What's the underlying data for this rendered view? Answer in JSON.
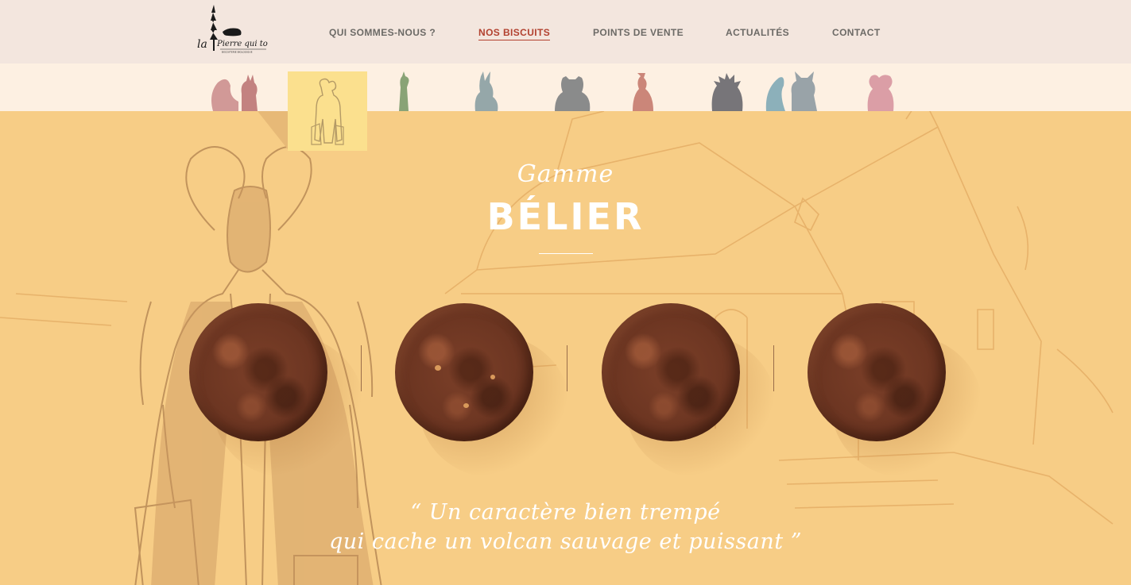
{
  "brand": {
    "logo_text": "la Pierre qui tourne",
    "logo_subtext": "BISCUITERIE BIOLOGIQUE"
  },
  "nav": {
    "items": [
      {
        "label": "QUI SOMMES-NOUS ?",
        "active": false
      },
      {
        "label": "NOS BISCUITS",
        "active": true
      },
      {
        "label": "POINTS DE VENTE",
        "active": false
      },
      {
        "label": "ACTUALITÉS",
        "active": false
      },
      {
        "label": "CONTACT",
        "active": false
      }
    ]
  },
  "animals": [
    {
      "name": "squirrel",
      "icon": "squirrel-icon"
    },
    {
      "name": "ram",
      "icon": "ram-icon",
      "selected": true
    },
    {
      "name": "giraffe",
      "icon": "giraffe-icon"
    },
    {
      "name": "hare",
      "icon": "hare-icon"
    },
    {
      "name": "bear",
      "icon": "bear-icon"
    },
    {
      "name": "bird",
      "icon": "bird-icon"
    },
    {
      "name": "hedgehog",
      "icon": "hedgehog-icon"
    },
    {
      "name": "fox",
      "icon": "fox-icon"
    },
    {
      "name": "mouse",
      "icon": "mouse-icon"
    }
  ],
  "hero": {
    "range_label": "Gamme",
    "range_name": "BÉLIER",
    "quote_line1": "“ Un caractère bien trempé",
    "quote_line2": "qui cache un volcan sauvage et puissant ”"
  },
  "cookies": [
    {
      "icon": "cookie-image"
    },
    {
      "icon": "cookie-image"
    },
    {
      "icon": "cookie-image"
    },
    {
      "icon": "cookie-image"
    }
  ],
  "colors": {
    "header_bg": "#f3e6de",
    "strip_bg": "#fdf0e2",
    "hero_bg": "#f7cd86",
    "selected_tile": "#fbe08e",
    "nav_active": "#b2412f",
    "nav_text": "#6c6a66"
  }
}
